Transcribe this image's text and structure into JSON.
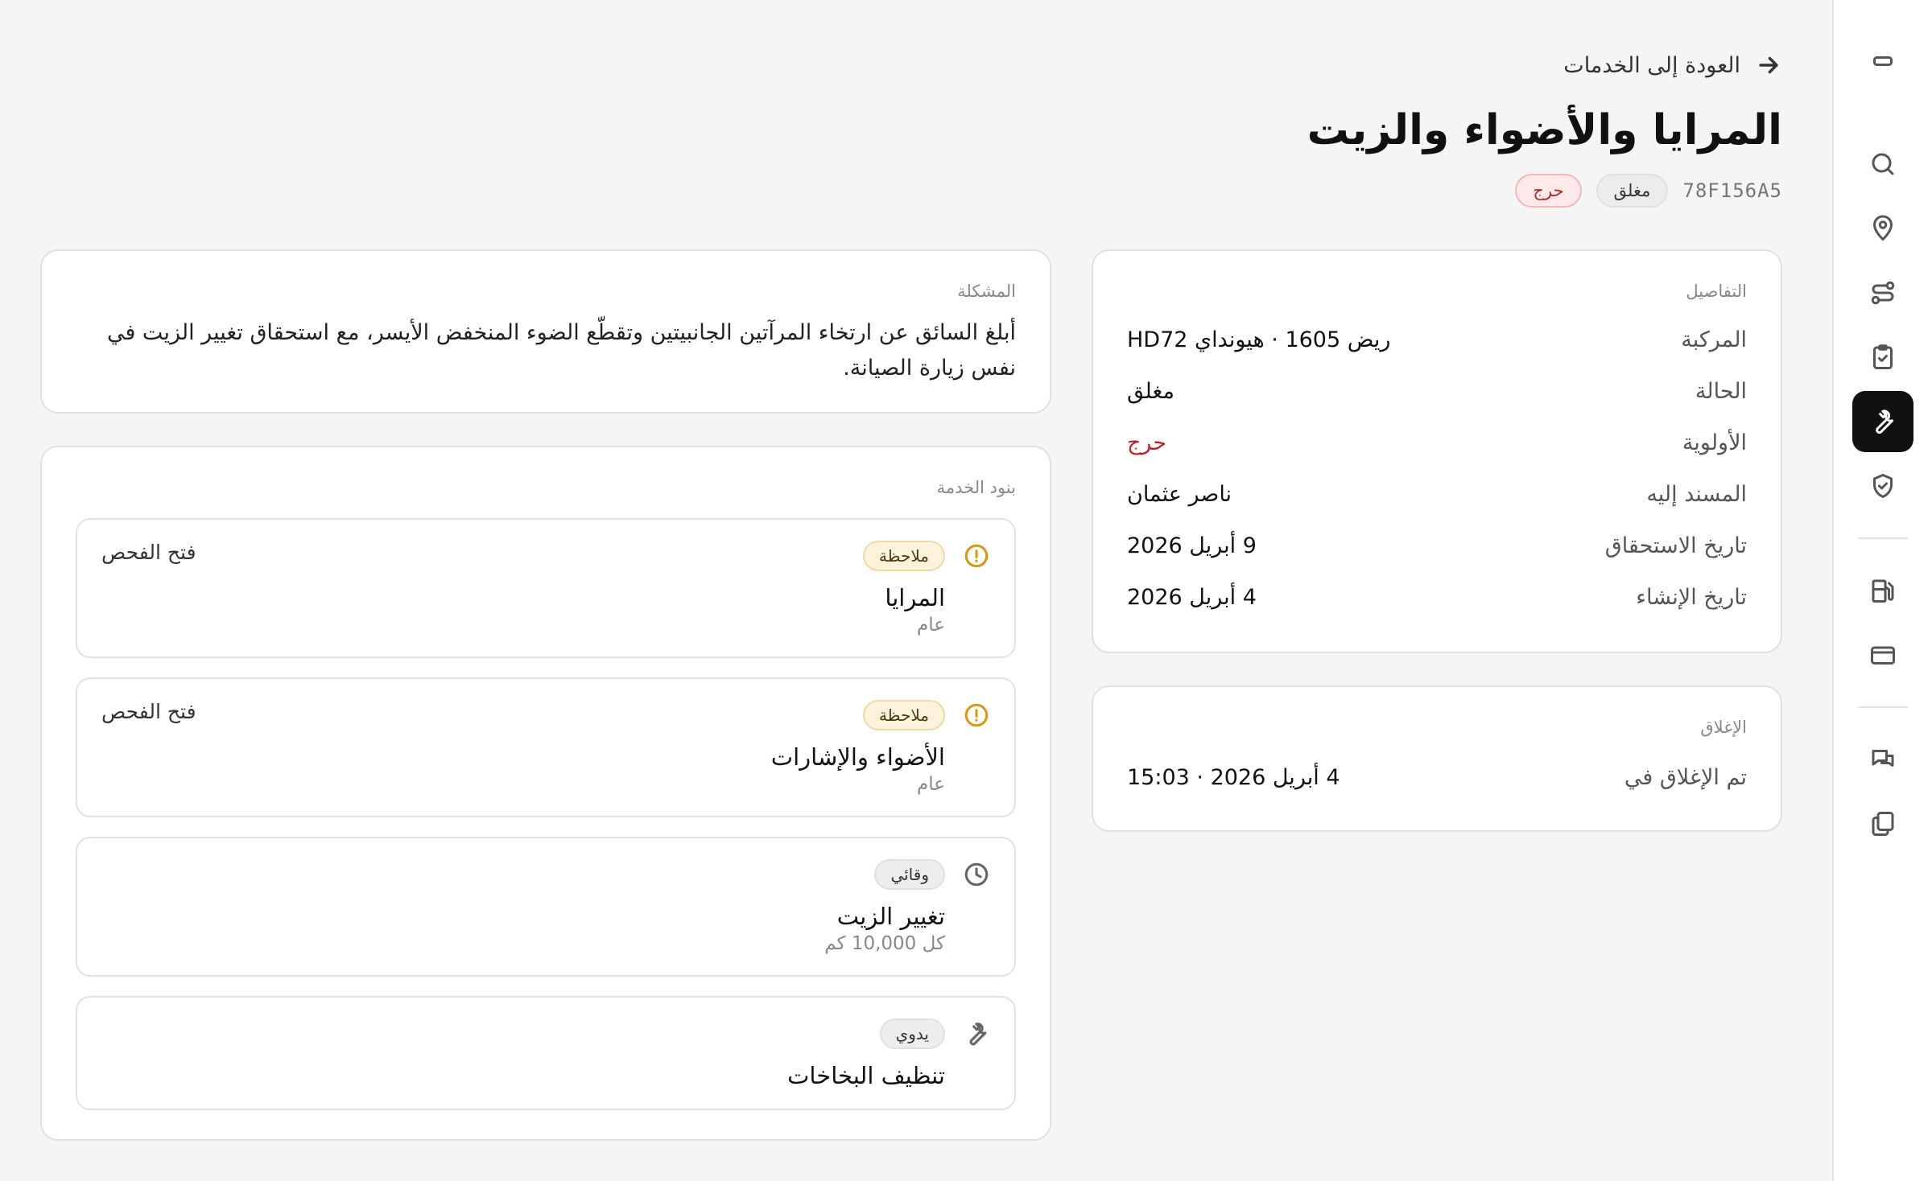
{
  "nav": {
    "back_label": "العودة إلى الخدمات",
    "sidebar_icons": [
      "logo-icon",
      "search-icon",
      "map-pin-icon",
      "route-icon",
      "clipboard-check-icon",
      "wrench-icon",
      "shield-check-icon",
      "fuel-icon",
      "credit-card-icon",
      "messages-icon",
      "documents-icon"
    ],
    "active_item": "wrench-icon"
  },
  "header": {
    "title": "المرايا والأضواء والزيت",
    "ticket_id": "78F156A5",
    "status_badge": "مغلق",
    "priority_badge": "حرج"
  },
  "details": {
    "label": "التفاصيل",
    "rows": [
      {
        "key": "المركبة",
        "value": "ريض 1605 · هيونداي HD72"
      },
      {
        "key": "الحالة",
        "value": "مغلق"
      },
      {
        "key": "الأولوية",
        "value": "حرج"
      },
      {
        "key": "المسند إليه",
        "value": "ناصر عثمان"
      },
      {
        "key": "تاريخ الاستحقاق",
        "value": "9 أبريل 2026"
      },
      {
        "key": "تاريخ الإنشاء",
        "value": "4 أبريل 2026"
      }
    ]
  },
  "closing": {
    "label": "الإغلاق",
    "key": "تم الإغلاق في",
    "value": "4 أبريل 2026 · 15:03"
  },
  "problem": {
    "label": "المشكلة",
    "text": "أبلغ السائق عن ارتخاء المرآتين الجانبيتين وتقطّع الضوء المنخفض الأيسر، مع استحقاق تغيير الزيت في نفس زيارة الصيانة."
  },
  "service_items": {
    "label": "بنود الخدمة",
    "items": [
      {
        "icon": "alert-circle-icon",
        "tag": "ملاحظة",
        "name": "المرايا",
        "sub": "عام",
        "action": "فتح الفحص"
      },
      {
        "icon": "alert-circle-icon",
        "tag": "ملاحظة",
        "name": "الأضواء والإشارات",
        "sub": "عام",
        "action": "فتح الفحص"
      },
      {
        "icon": "clock-icon",
        "tag": "وقائي",
        "name": "تغيير الزيت",
        "sub": "كل 10,000 كم",
        "action": ""
      },
      {
        "icon": "wrench-icon",
        "tag": "يدوي",
        "name": "تنظيف البخاخات",
        "sub": "",
        "action": ""
      }
    ]
  },
  "colors": {
    "critical": "#b12a2a",
    "note_amber": "#d49a1c",
    "active_nav": "#111111"
  }
}
